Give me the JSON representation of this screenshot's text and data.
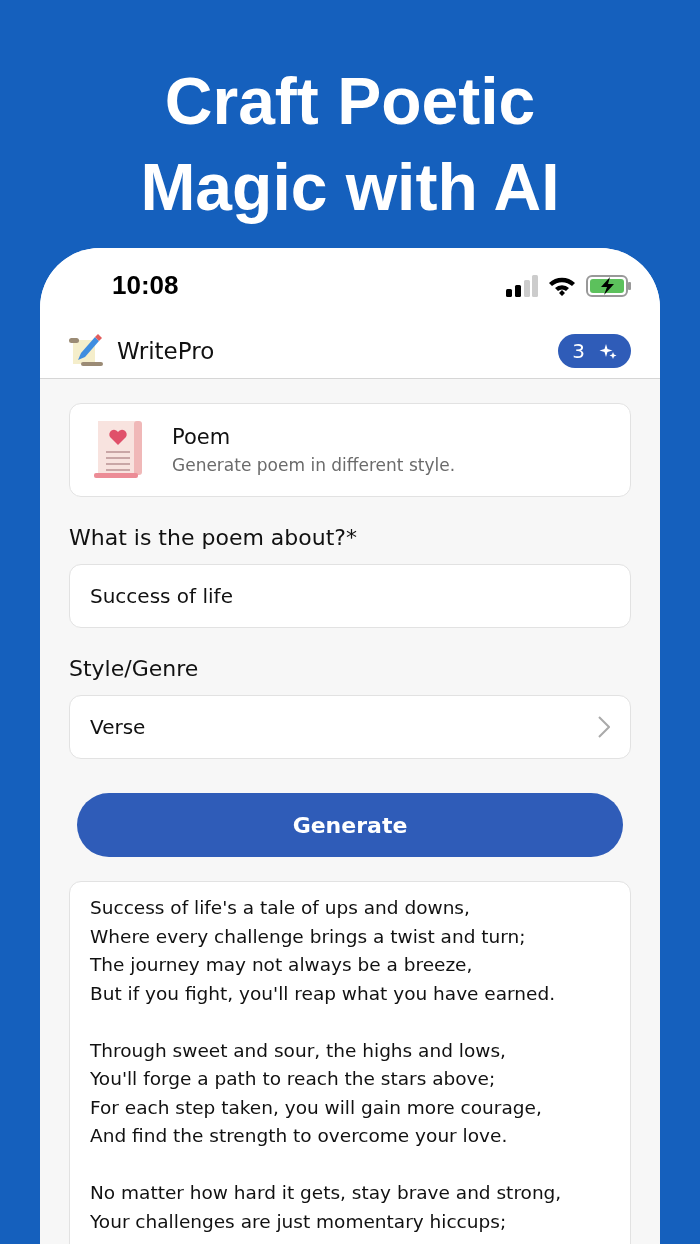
{
  "headline": "Craft Poetic Magic with AI",
  "status_bar": {
    "time": "10:08"
  },
  "app_bar": {
    "title": "WritePro",
    "credits": "3"
  },
  "tool_card": {
    "title": "Poem",
    "description": "Generate poem in different style."
  },
  "topic_field": {
    "label": "What is the poem about?*",
    "value": "Success of life"
  },
  "style_field": {
    "label": "Style/Genre",
    "value": "Verse"
  },
  "generate_button": "Generate",
  "poem_stanzas": [
    [
      "Success of life's a tale of ups and downs,",
      "Where every challenge brings a twist and turn;",
      "The journey may not always be a breeze,",
      "But if you fight, you'll reap what you have earned."
    ],
    [
      "Through sweet and sour, the highs and lows,",
      "You'll forge a path to reach the stars above;",
      "For each step taken, you will gain more courage,",
      "And find the strength to overcome your love."
    ],
    [
      "No matter how hard it gets, stay brave and strong,",
      "Your challenges are just momentary hiccups;"
    ]
  ]
}
